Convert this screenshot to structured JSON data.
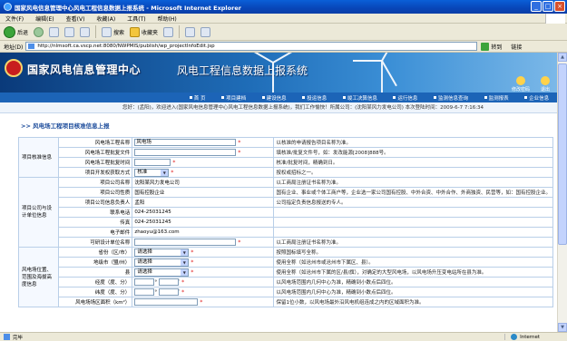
{
  "window": {
    "title": "国家风电信息管理中心风电工程信息数据上报系统 - Microsoft Internet Explorer",
    "buttons": [
      "_",
      "□",
      "×"
    ]
  },
  "menubar": {
    "items": [
      "文件(F)",
      "编辑(E)",
      "查看(V)",
      "收藏(A)",
      "工具(T)",
      "帮助(H)"
    ]
  },
  "toolbar": {
    "back_label": "后退",
    "search_label": "搜索",
    "favorites_label": "收藏夹"
  },
  "addressbar": {
    "label": "地址(D)",
    "url": "http://nlmsoft.ca.vscp.net:8080/NWPMIS/publish/wp_projectInfoEdit.jsp",
    "go_label": "转到",
    "links_label": "链接"
  },
  "banner": {
    "org_name": "国家风电信息管理中心",
    "system_name": "风电工程信息数据上报系统",
    "links": [
      "修改密码",
      "退出"
    ]
  },
  "nav": {
    "items": [
      "首 页",
      "项目建档",
      "建设信息",
      "投运信息",
      "竣工决算信息",
      "运行信息",
      "监测信息查询",
      "监测报表",
      "企业信息"
    ]
  },
  "welcome": "您好：(孟阳)，欢迎进入(国家风电信息管理中心风电工程信息数据上报系统)，我们工作愉快！所属公司：(沈阳某风力发电公司) 本次登陆时间：2009-6-7 7:16:34",
  "section_title": "风电场工程项目核准信息上报",
  "form": {
    "group_basic": "项目核准信息",
    "group_company": "项目公司与设计单位信息",
    "group_location": "风电场位置、范围及海拔高度信息",
    "rows": [
      {
        "label": "风电场工程名称",
        "value": "风电场",
        "note": "以核准的申请报告项目名称为准。"
      },
      {
        "label": "风电场工程批复文件",
        "value": "",
        "note": "填核准/批复文件号，如：发改能源[2008]888号。"
      },
      {
        "label": "风电场工程批复时间",
        "value": "",
        "note": "核准/批复时间，精确到日。"
      },
      {
        "label": "项目开发权获取方式",
        "value": "核准",
        "note": "按权或招标之一。"
      },
      {
        "label": "项目公司名称",
        "value": "沈阳某风力发电公司",
        "note": "以工商局注册证书名称为准。"
      },
      {
        "label": "项目公司性质",
        "value": "国有控股企业",
        "note": "国有企业、事业或个体工商户等，企业选一家公司国有控股、中外合资、中外合作、外商独资、民营等，如：国有控股企业。"
      },
      {
        "label": "项目公司信息负责人",
        "value": "孟阳",
        "note": "公司指定负责信息报送的专人。"
      },
      {
        "label": "联系电话",
        "value": "024-25031245",
        "note": ""
      },
      {
        "label": "传真",
        "value": "024-25031245",
        "note": ""
      },
      {
        "label": "电子邮件",
        "value": "zhaoyu@163.com",
        "note": ""
      },
      {
        "label": "可研设计单位名称",
        "value": "",
        "note": "以工商局注册证书名称为准。"
      },
      {
        "label": "省份（区/市）",
        "value": "请选择",
        "note": "按照国标填写全称。"
      },
      {
        "label": "地级市（盟/州）",
        "value": "请选择",
        "note": "使用全称（如沧州市或沧州市下属区、县）。"
      },
      {
        "label": "县",
        "value": "请选择",
        "note": "使用全称（如沧州市下属的区/县/旗），对确定的大型风电场，以风电场升压变电站所在县为准。"
      },
      {
        "label": "经度（度、分）",
        "note": "以风电场范围内几何中心为准，精确到小数点后四位。"
      },
      {
        "label": "纬度（度、分）",
        "note": "以风电场范围内几何中心为准，精确到小数点后四位。"
      },
      {
        "label": "风电场场区面积（km²）",
        "value": "",
        "note": "保留1位小数，以风电场最外沿风电机组连成之内的区域面积为准。"
      }
    ]
  },
  "statusbar": {
    "status": "完毕",
    "zone": "Internet"
  },
  "colors": {
    "nav_bg": "#1c64b7",
    "required": "#e02020",
    "section_title": "#1a4a9a"
  }
}
